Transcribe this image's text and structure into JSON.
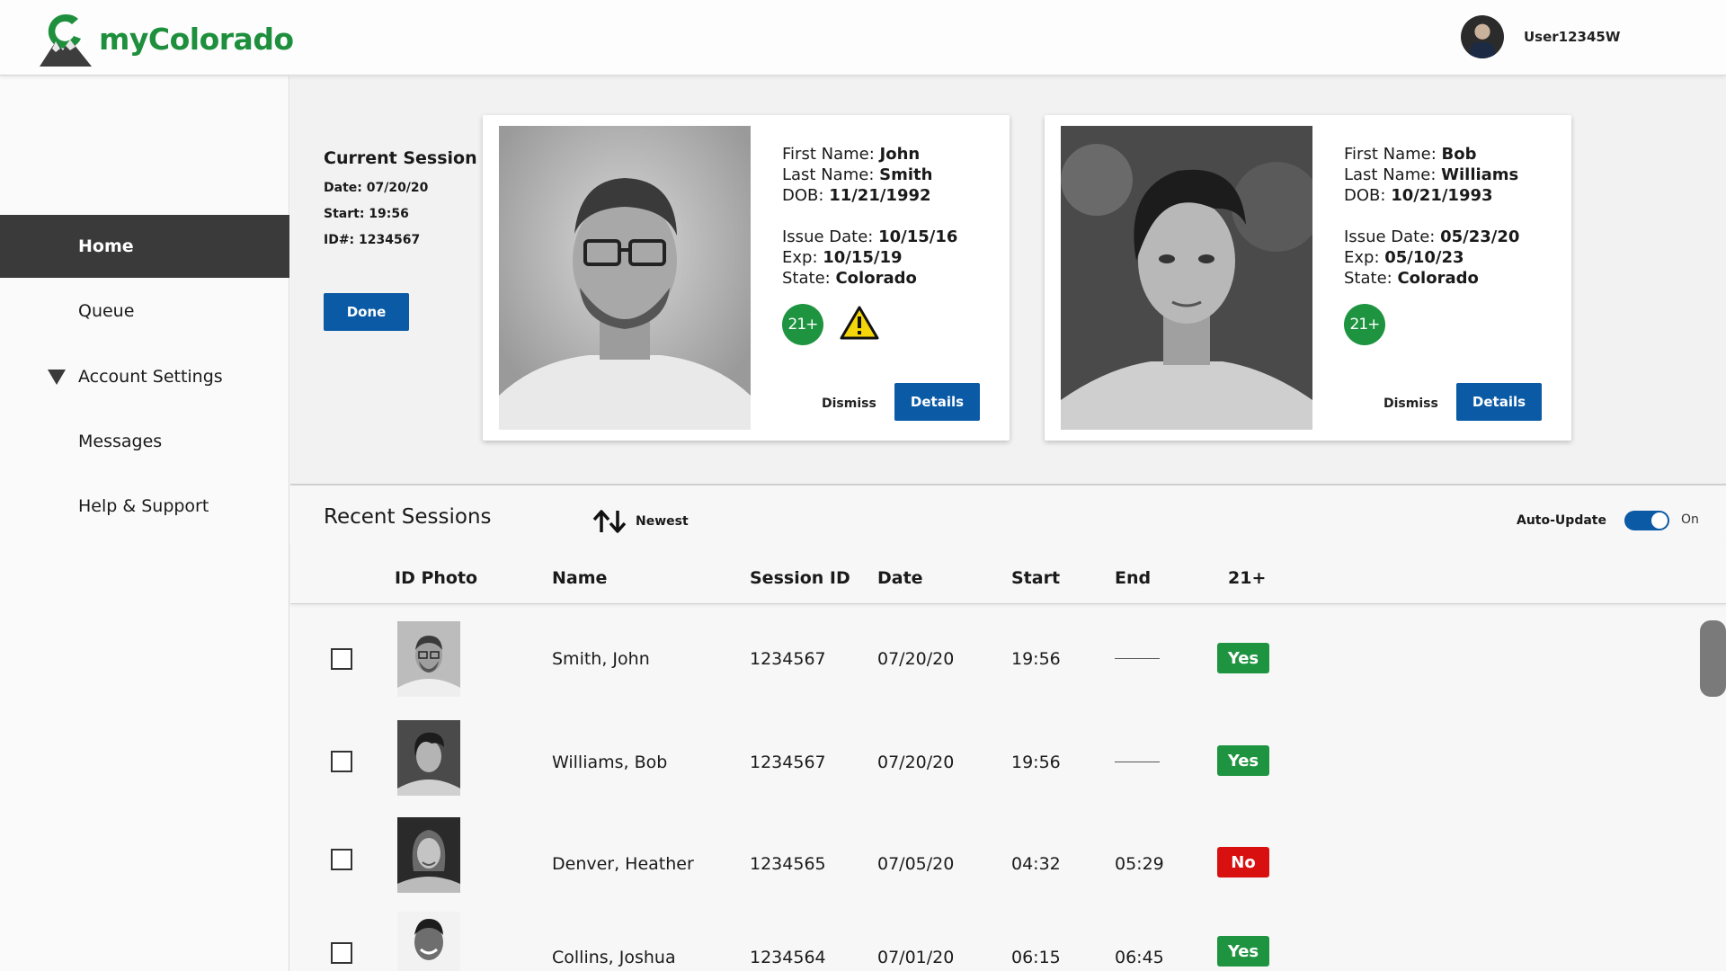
{
  "app": {
    "brand": "myColorado",
    "username": "User12345W"
  },
  "colors": {
    "brand_green": "#1e8f3c",
    "primary_blue": "#0a5aa5",
    "nav_active": "#3a3a3a",
    "yes_green": "#1e9440",
    "no_red": "#d81010"
  },
  "sidebar": {
    "items": [
      {
        "label": "Home",
        "active": true
      },
      {
        "label": "Queue"
      },
      {
        "label": "Account Settings",
        "icon": "caret-down-icon"
      },
      {
        "label": "Messages"
      },
      {
        "label": "Help & Support"
      }
    ]
  },
  "session": {
    "title": "Current Session",
    "date": "Date: 07/20/20",
    "start": "Start: 19:56",
    "id": "ID#: 1234567",
    "done_label": "Done"
  },
  "cards": [
    {
      "first_label": "First Name:",
      "first": "John",
      "last_label": "Last Name:",
      "last": "Smith",
      "dob_label": "DOB:",
      "dob": "11/21/1992",
      "issue_label": "Issue Date:",
      "issue": "10/15/16",
      "exp_label": "Exp:",
      "exp": "10/15/19",
      "state_label": "State:",
      "state": "Colorado",
      "badge": "21+",
      "warning": true,
      "dismiss": "Dismiss",
      "details": "Details"
    },
    {
      "first_label": "First Name:",
      "first": "Bob",
      "last_label": "Last Name:",
      "last": "Williams",
      "dob_label": "DOB:",
      "dob": "10/21/1993",
      "issue_label": "Issue Date:",
      "issue": "05/23/20",
      "exp_label": "Exp:",
      "exp": "05/10/23",
      "state_label": "State:",
      "state": "Colorado",
      "badge": "21+",
      "warning": false,
      "dismiss": "Dismiss",
      "details": "Details"
    }
  ],
  "recent": {
    "title": "Recent Sessions",
    "sort_label": "Newest",
    "auto_update_label": "Auto-Update",
    "auto_update_state": "On",
    "columns": [
      "ID Photo",
      "Name",
      "Session ID",
      "Date",
      "Start",
      "End",
      "21+"
    ],
    "rows": [
      {
        "name": "Smith, John",
        "session_id": "1234567",
        "date": "07/20/20",
        "start": "19:56",
        "end": "",
        "age21": "Yes"
      },
      {
        "name": "Williams, Bob",
        "session_id": "1234567",
        "date": "07/20/20",
        "start": "19:56",
        "end": "",
        "age21": "Yes"
      },
      {
        "name": "Denver, Heather",
        "session_id": "1234565",
        "date": "07/05/20",
        "start": "04:32",
        "end": "05:29",
        "age21": "No"
      },
      {
        "name": "Collins, Joshua",
        "session_id": "1234564",
        "date": "07/01/20",
        "start": "06:15",
        "end": "06:45",
        "age21": "Yes"
      }
    ]
  }
}
